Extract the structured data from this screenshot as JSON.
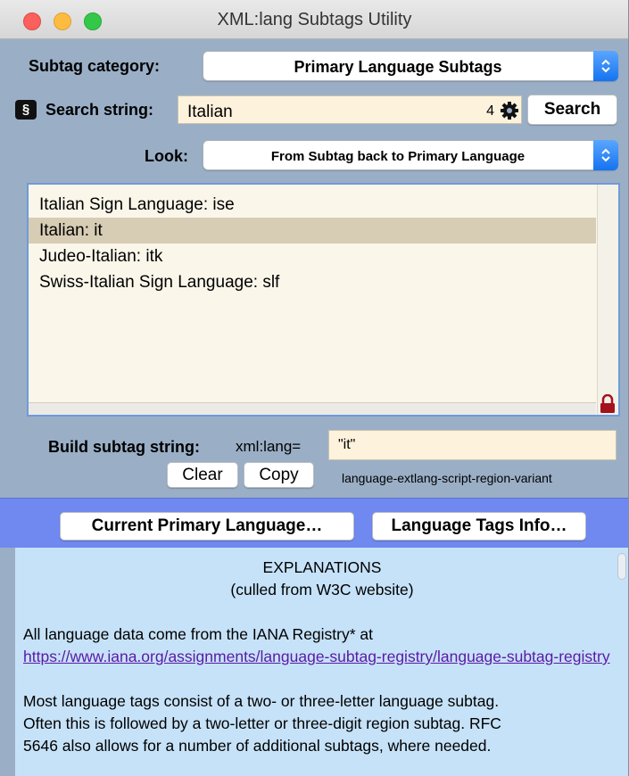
{
  "window": {
    "title": "XML:lang Subtags Utility"
  },
  "category": {
    "label": "Subtag category:",
    "selected": "Primary Language Subtags"
  },
  "search": {
    "icon_glyph": "§",
    "label": "Search string:",
    "value": "Italian",
    "count": "4",
    "button_label": "Search"
  },
  "look": {
    "label": "Look:",
    "selected": "From Subtag back to Primary Language"
  },
  "results": {
    "items": [
      {
        "label": "Italian Sign Language: ise",
        "selected": false
      },
      {
        "label": "Italian: it",
        "selected": true
      },
      {
        "label": "Judeo-Italian: itk",
        "selected": false
      },
      {
        "label": "Swiss-Italian Sign Language: slf",
        "selected": false
      }
    ]
  },
  "build": {
    "label": "Build subtag string:",
    "prefix": "xml:lang=",
    "value": "\"it\"",
    "clear_label": "Clear",
    "copy_label": "Copy",
    "format_hint": "language-extlang-script-region-variant"
  },
  "actions": {
    "current_language_label": "Current Primary Language…",
    "tags_info_label": "Language Tags Info…"
  },
  "explanations": {
    "heading": "EXPLANATIONS",
    "subheading": "(culled from W3C website)",
    "registry_text": "All language data come from the IANA Registry* at",
    "registry_link": "https://www.iana.org/assignments/language-subtag-registry/language-subtag-registry",
    "paragraph_line1": "Most language tags consist of a two- or three-letter language subtag.",
    "paragraph_line2": "Often this is followed by a two-letter or three-digit region subtag. RFC",
    "paragraph_line3": "5646 also allows for a number of additional subtags,  where needed."
  },
  "colors": {
    "window_bg": "#9aafc6",
    "field_bg": "#fdf2dc",
    "list_bg": "#faf6ea",
    "selection": "#d7ccb4",
    "band": "#6f89f0",
    "explain_bg": "#c6e2f8",
    "accent": "#1573f0",
    "lock": "#a3121d"
  }
}
